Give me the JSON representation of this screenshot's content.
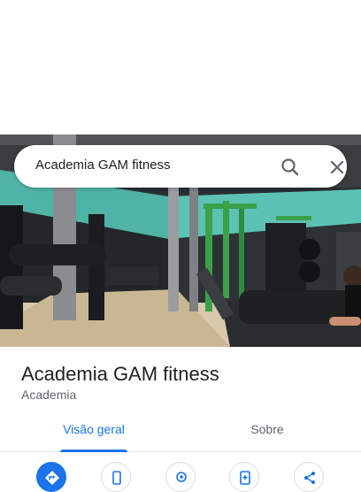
{
  "search": {
    "query": "Academia GAM fitness"
  },
  "place": {
    "title": "Academia GAM fitness",
    "category": "Academia"
  },
  "tabs": [
    {
      "label": "Visão geral",
      "active": true
    },
    {
      "label": "Sobre",
      "active": false
    }
  ],
  "actions": [
    {
      "icon": "directions-icon",
      "primary": true
    },
    {
      "icon": "phone-icon",
      "primary": false
    },
    {
      "icon": "location-icon",
      "primary": false
    },
    {
      "icon": "save-icon",
      "primary": false
    },
    {
      "icon": "share-icon",
      "primary": false
    }
  ],
  "colors": {
    "accent": "#1a73e8",
    "text_primary": "#202124",
    "text_secondary": "#5f6368",
    "teal_wall": "#4fb3a6",
    "equipment_green": "#3aa14a"
  }
}
